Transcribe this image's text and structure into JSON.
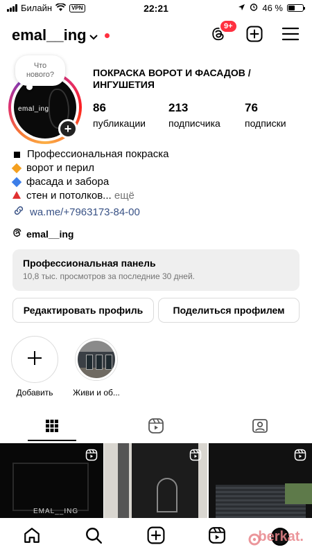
{
  "status": {
    "carrier": "Билайн",
    "vpn": "VPN",
    "time": "22:21",
    "battery": "46 %",
    "battery_level": 0.46
  },
  "header": {
    "username": "emal__ing",
    "notif_badge": "9+"
  },
  "profile": {
    "note": "Что нового?",
    "avatar_text": "emal_ing",
    "name_line1": "ПОКРАСКА ВОРОТ И ФАСАДОВ /",
    "name_line2": "ИНГУШЕТИЯ",
    "stats": [
      {
        "num": "86",
        "label": "публикации"
      },
      {
        "num": "213",
        "label": "подписчика"
      },
      {
        "num": "76",
        "label": "подписки"
      }
    ],
    "bio": [
      {
        "text": "Профессиональная покраска",
        "color": "#000000"
      },
      {
        "text": "ворот и перил",
        "color": "#f4a020"
      },
      {
        "text": "фасада и забора",
        "color": "#3c7ee8"
      },
      {
        "text": "стен и потолков...",
        "color": "#e03030",
        "more": "ещё"
      }
    ],
    "link": "wa.me/+7963173-84-00",
    "threads": "emal__ing"
  },
  "panel": {
    "title": "Профессиональная панель",
    "subtitle": "10,8 тыс. просмотров за последние 30 дней."
  },
  "buttons": {
    "edit": "Редактировать профиль",
    "share": "Поделиться профилем"
  },
  "highlights": [
    {
      "label": "Добавить"
    },
    {
      "label": "Живи и об..."
    }
  ],
  "grid": {
    "cell1_caption": "EMAL__ING"
  },
  "watermark": "berkat."
}
